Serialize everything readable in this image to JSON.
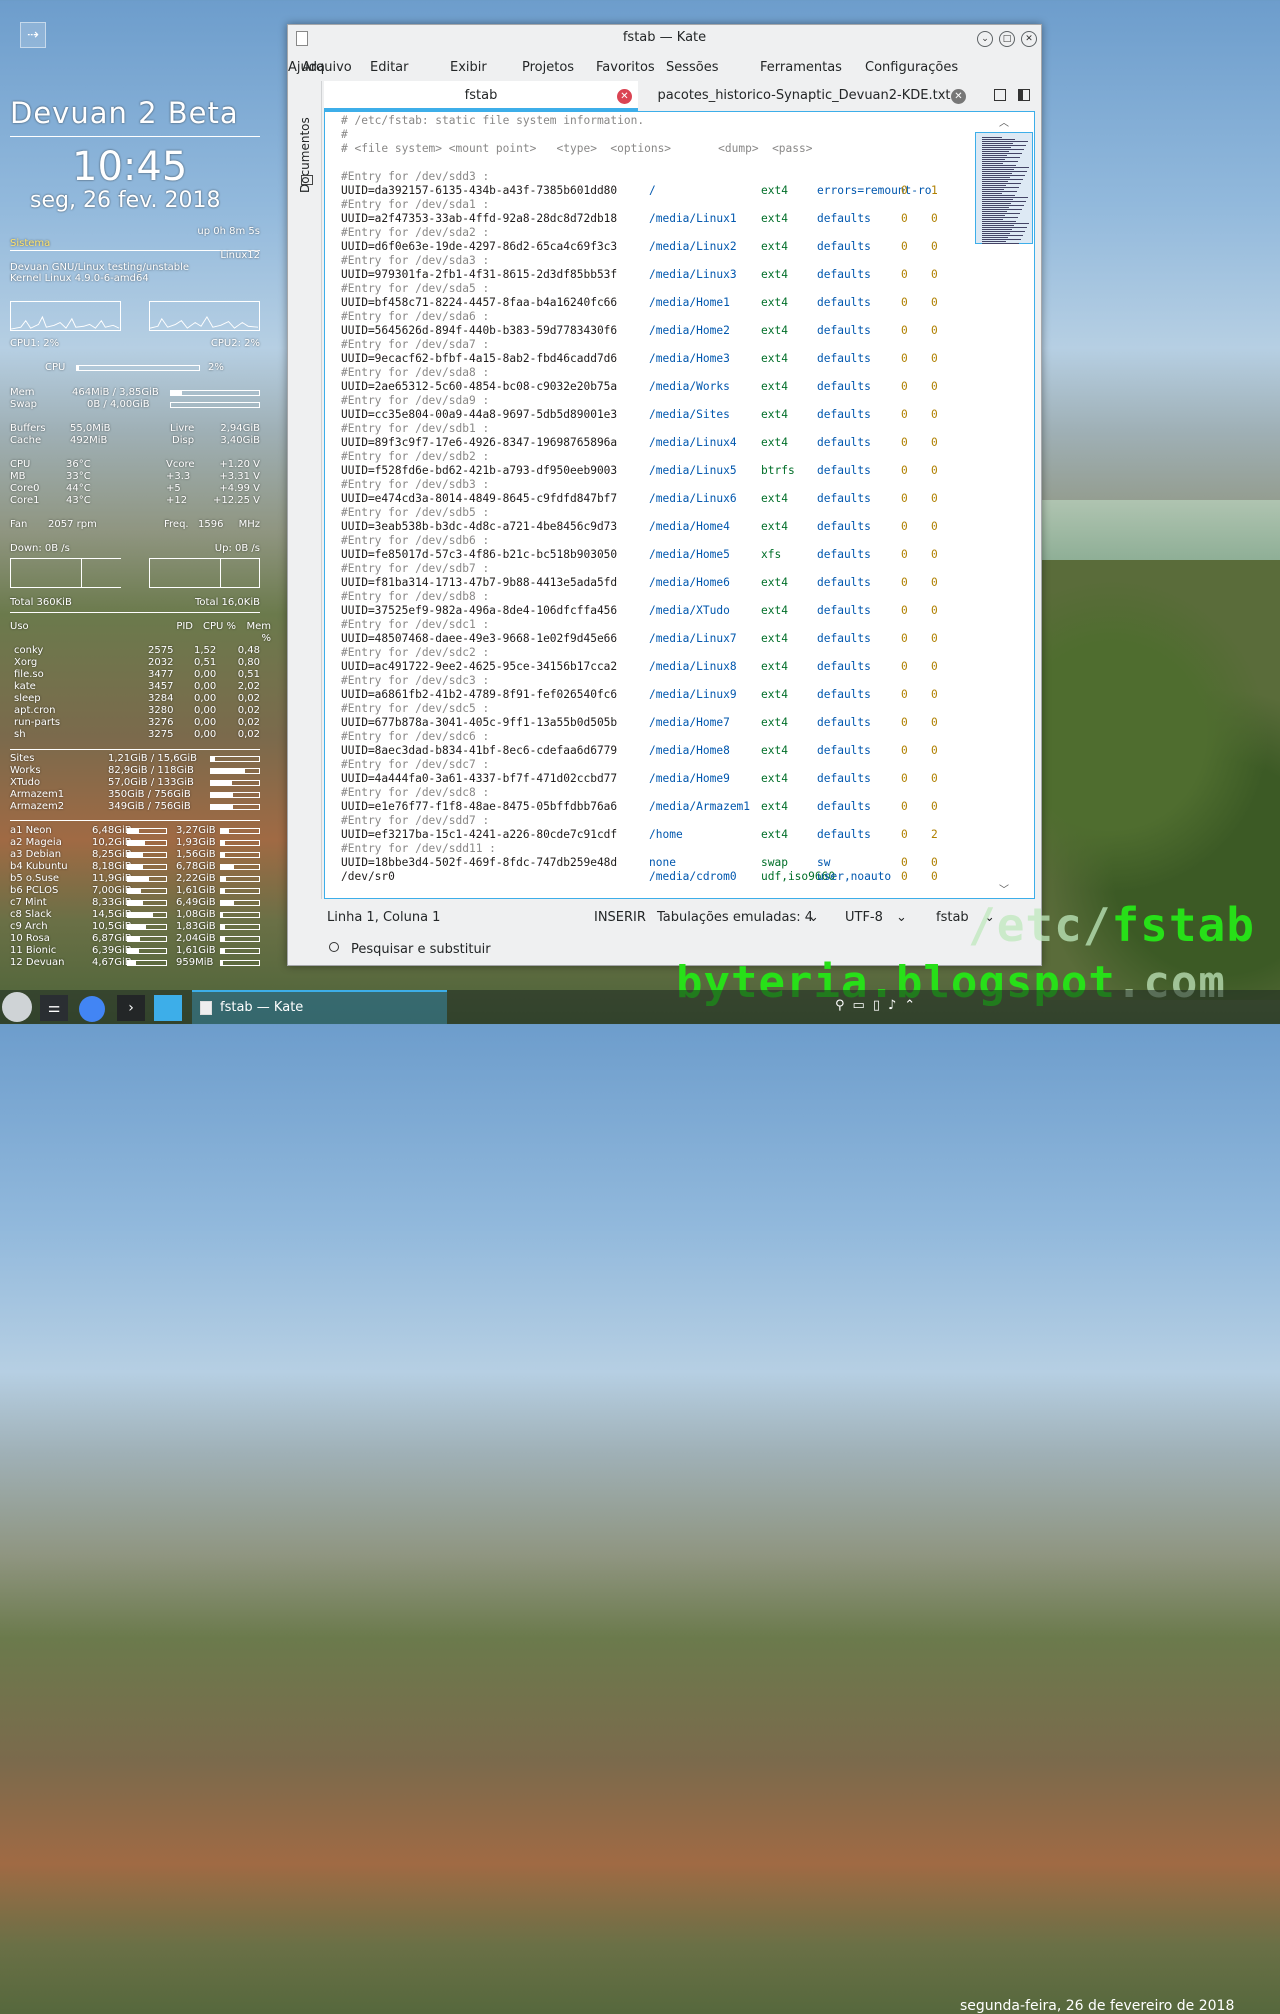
{
  "conky": {
    "title": "Devuan 2 Beta",
    "time": "10:45",
    "date": "seg, 26 fev. 2018",
    "uptime": "up 0h 8m 5s",
    "sistema_label": "Sistema",
    "hostname": "Linux12",
    "os": "Devuan GNU/Linux testing/unstable",
    "kernel": "Kernel Linux 4.9.0-6-amd64",
    "cpu1": "CPU1: 2%",
    "cpu2": "CPU2: 2%",
    "cpu_label": "CPU",
    "cpu_total": "2%",
    "mem_label": "Mem",
    "mem_val": "464MiB / 3,85GiB",
    "mem_frac": 0.12,
    "swap_label": "Swap",
    "swap_val": "0B   / 4,00GiB",
    "swap_frac": 0,
    "buffers_label": "Buffers",
    "buffers_val": "55,0MiB",
    "livre_label": "Livre",
    "livre_val": "2,94GiB",
    "cache_label": "Cache",
    "cache_val": "492MiB",
    "disp_label": "Disp",
    "disp_val": "3,40GiB",
    "temps": [
      {
        "l": "CPU",
        "v": "36°C",
        "l2": "Vcore",
        "v2": "+1.20 V"
      },
      {
        "l": "MB",
        "v": "33°C",
        "l2": "+3.3",
        "v2": "+3.31 V"
      },
      {
        "l": "Core0",
        "v": "44°C",
        "l2": "+5",
        "v2": "+4.99 V"
      },
      {
        "l": "Core1",
        "v": "43°C",
        "l2": "+12",
        "v2": "+12.25 V"
      }
    ],
    "fan_label": "Fan",
    "fan_val": "2057 rpm",
    "freq_label": "Freq.",
    "freq_val": "1596",
    "freq_unit": "MHz",
    "down": "Down: 0B  /s",
    "up": "Up: 0B  /s",
    "total_down": "Total 360KiB",
    "total_up": "Total 16,0KiB",
    "proc_head": [
      "Uso",
      "PID",
      "CPU %",
      "Mem %"
    ],
    "procs": [
      [
        "conky",
        "2575",
        "1,52",
        "0,48"
      ],
      [
        "Xorg",
        "2032",
        "0,51",
        "0,80"
      ],
      [
        "file.so",
        "3477",
        "0,00",
        "0,51"
      ],
      [
        "kate",
        "3457",
        "0,00",
        "2,02"
      ],
      [
        "sleep",
        "3284",
        "0,00",
        "0,02"
      ],
      [
        "apt.cron",
        "3280",
        "0,00",
        "0,02"
      ],
      [
        "run-parts",
        "3276",
        "0,00",
        "0,02"
      ],
      [
        "sh",
        "3275",
        "0,00",
        "0,02"
      ]
    ],
    "disks": [
      {
        "n": "Sites",
        "v": "1,21GiB / 15,6GiB",
        "f": 0.08
      },
      {
        "n": "Works",
        "v": "82,9GiB / 118GiB",
        "f": 0.7
      },
      {
        "n": "XTudo",
        "v": "57,0GiB / 133GiB",
        "f": 0.43
      },
      {
        "n": "Armazem1",
        "v": "350GiB / 756GiB",
        "f": 0.46
      },
      {
        "n": "Armazem2",
        "v": "349GiB / 756GiB",
        "f": 0.46
      }
    ],
    "parts": [
      {
        "n": "a1 Neon",
        "u": "6,48GiB",
        "uf": 0.3,
        "f": "3,27GiB",
        "ff": 0.2
      },
      {
        "n": "a2 Mageia",
        "u": "10,2GiB",
        "uf": 0.45,
        "f": "1,93GiB",
        "ff": 0.1
      },
      {
        "n": "a3 Debian",
        "u": "8,25GiB",
        "uf": 0.4,
        "f": "1,56GiB",
        "ff": 0.1
      },
      {
        "n": "b4 Kubuntu",
        "u": "8,18GiB",
        "uf": 0.4,
        "f": "6,78GiB",
        "ff": 0.35
      },
      {
        "n": "b5 o.Suse",
        "u": "11,9GiB",
        "uf": 0.55,
        "f": "2,22GiB",
        "ff": 0.12
      },
      {
        "n": "b6 PCLOS",
        "u": "7,00GiB",
        "uf": 0.35,
        "f": "1,61GiB",
        "ff": 0.1
      },
      {
        "n": "c7 Mint",
        "u": "8,33GiB",
        "uf": 0.4,
        "f": "6,49GiB",
        "ff": 0.33
      },
      {
        "n": "c8 Slack",
        "u": "14,5GiB",
        "uf": 0.65,
        "f": "1,08GiB",
        "ff": 0.06
      },
      {
        "n": "c9 Arch",
        "u": "10,5GiB",
        "uf": 0.48,
        "f": "1,83GiB",
        "ff": 0.1
      },
      {
        "n": "10 Rosa",
        "u": "6,87GiB",
        "uf": 0.32,
        "f": "2,04GiB",
        "ff": 0.1
      },
      {
        "n": "11 Bionic",
        "u": "6,39GiB",
        "uf": 0.3,
        "f": "1,61GiB",
        "ff": 0.1
      },
      {
        "n": "12 Devuan",
        "u": "4,67GiB",
        "uf": 0.22,
        "f": "959MiB",
        "ff": 0.05
      }
    ]
  },
  "window": {
    "title": "fstab — Kate"
  },
  "menu": [
    "Arquivo",
    "Editar",
    "Exibir",
    "Projetos",
    "Favoritos",
    "Sessões",
    "Ferramentas",
    "Configurações",
    "Ajuda"
  ],
  "side_label": "Documentos",
  "tabs": [
    "fstab",
    "pacotes_historico-Synaptic_Devuan2-KDE.txt"
  ],
  "header_lines": [
    "# /etc/fstab: static file system information.",
    "#",
    "# <file system> <mount point>   <type>  <options>       <dump>  <pass>",
    ""
  ],
  "entries": [
    {
      "c": "#Entry for /dev/sdd3 :",
      "u": "UUID=da392157-6135-434b-a43f-7385b601dd80",
      "m": "/",
      "t": "ext4",
      "o": "errors=remount-ro",
      "d": "0",
      "p": "1"
    },
    {
      "c": "#Entry for /dev/sda1 :",
      "u": "UUID=a2f47353-33ab-4ffd-92a8-28dc8d72db18",
      "m": "/media/Linux1",
      "t": "ext4",
      "o": "defaults",
      "d": "0",
      "p": "0"
    },
    {
      "c": "#Entry for /dev/sda2 :",
      "u": "UUID=d6f0e63e-19de-4297-86d2-65ca4c69f3c3",
      "m": "/media/Linux2",
      "t": "ext4",
      "o": "defaults",
      "d": "0",
      "p": "0"
    },
    {
      "c": "#Entry for /dev/sda3 :",
      "u": "UUID=979301fa-2fb1-4f31-8615-2d3df85bb53f",
      "m": "/media/Linux3",
      "t": "ext4",
      "o": "defaults",
      "d": "0",
      "p": "0"
    },
    {
      "c": "#Entry for /dev/sda5 :",
      "u": "UUID=bf458c71-8224-4457-8faa-b4a16240fc66",
      "m": "/media/Home1",
      "t": "ext4",
      "o": "defaults",
      "d": "0",
      "p": "0"
    },
    {
      "c": "#Entry for /dev/sda6 :",
      "u": "UUID=5645626d-894f-440b-b383-59d7783430f6",
      "m": "/media/Home2",
      "t": "ext4",
      "o": "defaults",
      "d": "0",
      "p": "0"
    },
    {
      "c": "#Entry for /dev/sda7 :",
      "u": "UUID=9ecacf62-bfbf-4a15-8ab2-fbd46cadd7d6",
      "m": "/media/Home3",
      "t": "ext4",
      "o": "defaults",
      "d": "0",
      "p": "0"
    },
    {
      "c": "#Entry for /dev/sda8 :",
      "u": "UUID=2ae65312-5c60-4854-bc08-c9032e20b75a",
      "m": "/media/Works",
      "t": "ext4",
      "o": "defaults",
      "d": "0",
      "p": "0"
    },
    {
      "c": "#Entry for /dev/sda9 :",
      "u": "UUID=cc35e804-00a9-44a8-9697-5db5d89001e3",
      "m": "/media/Sites",
      "t": "ext4",
      "o": "defaults",
      "d": "0",
      "p": "0"
    },
    {
      "c": "#Entry for /dev/sdb1 :",
      "u": "UUID=89f3c9f7-17e6-4926-8347-19698765896a",
      "m": "/media/Linux4",
      "t": "ext4",
      "o": "defaults",
      "d": "0",
      "p": "0"
    },
    {
      "c": "#Entry for /dev/sdb2 :",
      "u": "UUID=f528fd6e-bd62-421b-a793-df950eeb9003",
      "m": "/media/Linux5",
      "t": "btrfs",
      "o": "defaults",
      "d": "0",
      "p": "0"
    },
    {
      "c": "#Entry for /dev/sdb3 :",
      "u": "UUID=e474cd3a-8014-4849-8645-c9fdfd847bf7",
      "m": "/media/Linux6",
      "t": "ext4",
      "o": "defaults",
      "d": "0",
      "p": "0"
    },
    {
      "c": "#Entry for /dev/sdb5 :",
      "u": "UUID=3eab538b-b3dc-4d8c-a721-4be8456c9d73",
      "m": "/media/Home4",
      "t": "ext4",
      "o": "defaults",
      "d": "0",
      "p": "0"
    },
    {
      "c": "#Entry for /dev/sdb6 :",
      "u": "UUID=fe85017d-57c3-4f86-b21c-bc518b903050",
      "m": "/media/Home5",
      "t": "xfs",
      "o": "defaults",
      "d": "0",
      "p": "0"
    },
    {
      "c": "#Entry for /dev/sdb7 :",
      "u": "UUID=f81ba314-1713-47b7-9b88-4413e5ada5fd",
      "m": "/media/Home6",
      "t": "ext4",
      "o": "defaults",
      "d": "0",
      "p": "0"
    },
    {
      "c": "#Entry for /dev/sdb8 :",
      "u": "UUID=37525ef9-982a-496a-8de4-106dfcffa456",
      "m": "/media/XTudo",
      "t": "ext4",
      "o": "defaults",
      "d": "0",
      "p": "0"
    },
    {
      "c": "#Entry for /dev/sdc1 :",
      "u": "UUID=48507468-daee-49e3-9668-1e02f9d45e66",
      "m": "/media/Linux7",
      "t": "ext4",
      "o": "defaults",
      "d": "0",
      "p": "0"
    },
    {
      "c": "#Entry for /dev/sdc2 :",
      "u": "UUID=ac491722-9ee2-4625-95ce-34156b17cca2",
      "m": "/media/Linux8",
      "t": "ext4",
      "o": "defaults",
      "d": "0",
      "p": "0"
    },
    {
      "c": "#Entry for /dev/sdc3 :",
      "u": "UUID=a6861fb2-41b2-4789-8f91-fef026540fc6",
      "m": "/media/Linux9",
      "t": "ext4",
      "o": "defaults",
      "d": "0",
      "p": "0"
    },
    {
      "c": "#Entry for /dev/sdc5 :",
      "u": "UUID=677b878a-3041-405c-9ff1-13a55b0d505b",
      "m": "/media/Home7",
      "t": "ext4",
      "o": "defaults",
      "d": "0",
      "p": "0"
    },
    {
      "c": "#Entry for /dev/sdc6 :",
      "u": "UUID=8aec3dad-b834-41bf-8ec6-cdefaa6d6779",
      "m": "/media/Home8",
      "t": "ext4",
      "o": "defaults",
      "d": "0",
      "p": "0"
    },
    {
      "c": "#Entry for /dev/sdc7 :",
      "u": "UUID=4a444fa0-3a61-4337-bf7f-471d02ccbd77",
      "m": "/media/Home9",
      "t": "ext4",
      "o": "defaults",
      "d": "0",
      "p": "0"
    },
    {
      "c": "#Entry for /dev/sdc8 :",
      "u": "UUID=e1e76f77-f1f8-48ae-8475-05bffdbb76a6",
      "m": "/media/Armazem1",
      "t": "ext4",
      "o": "defaults",
      "d": "0",
      "p": "0"
    },
    {
      "c": "#Entry for /dev/sdd7 :",
      "u": "UUID=ef3217ba-15c1-4241-a226-80cde7c91cdf",
      "m": "/home",
      "t": "ext4",
      "o": "defaults",
      "d": "0",
      "p": "2"
    },
    {
      "c": "#Entry for /dev/sdd11 :",
      "u": "UUID=18bbe3d4-502f-469f-8fdc-747db259e48d",
      "m": "none",
      "t": "swap",
      "o": "sw",
      "d": "0",
      "p": "0"
    }
  ],
  "last_line": {
    "u": "/dev/sr0",
    "m": "/media/cdrom0",
    "t": "udf,iso9660",
    "o": "user,noauto",
    "d": "0",
    "p": "0"
  },
  "status": {
    "position": "Linha 1, Coluna 1",
    "mode": "INSERIR",
    "tabs": "Tabulações emuladas: 4",
    "encoding": "UTF-8",
    "syntax": "fstab"
  },
  "search": {
    "label": "Pesquisar e substituir"
  },
  "overlay": {
    "line1_dim": "/etc/",
    "line1": "fstab",
    "line2": "byteria.blogspot",
    "line2_dim": ".com"
  },
  "taskbar": {
    "task": "fstab  — Kate",
    "date": "segunda-feira, 26 de fevereiro de 2018"
  },
  "colors": {
    "accent": "#3daee9",
    "close": "#da4453",
    "watermark": "#27e018"
  }
}
